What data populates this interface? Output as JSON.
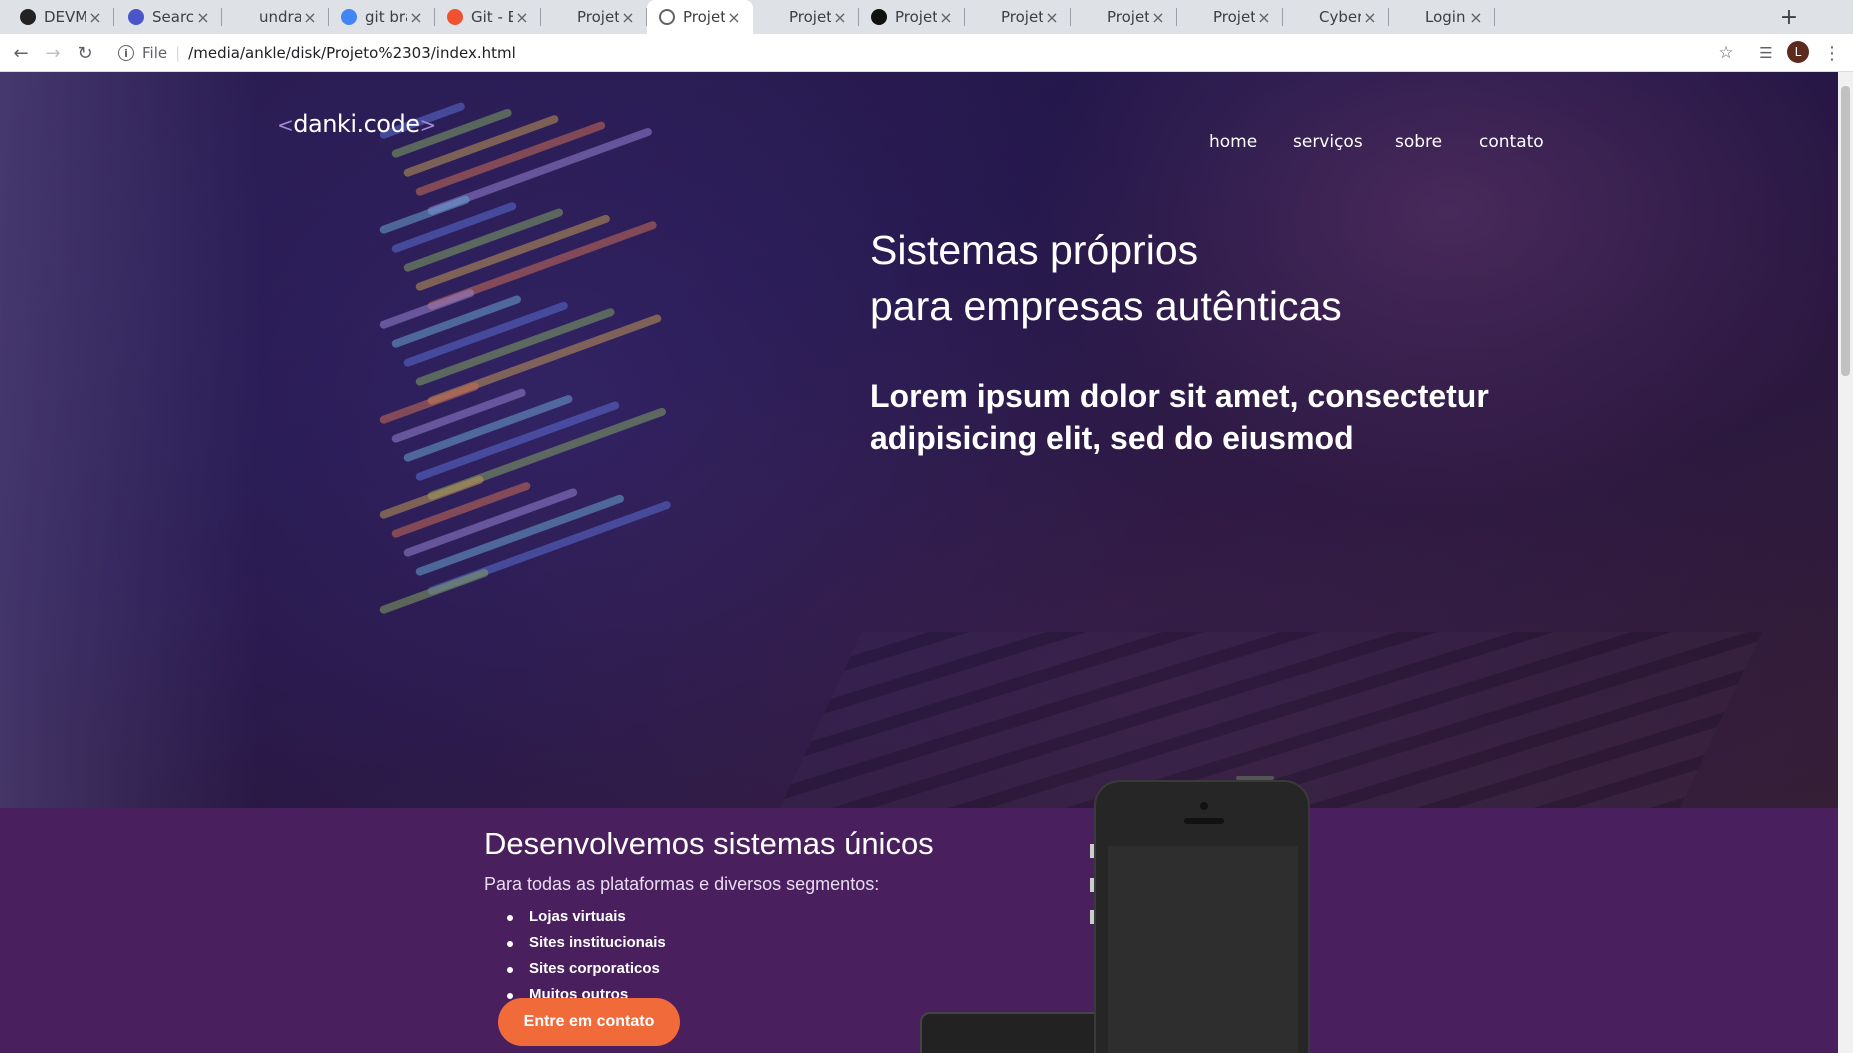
{
  "browser": {
    "tabs": [
      {
        "title": "DEVMO",
        "favicon": "devmo-icon",
        "active": false
      },
      {
        "title": "Search |",
        "favicon": "search-icon",
        "active": false
      },
      {
        "title": "undraw_",
        "favicon": "blank-icon",
        "active": false
      },
      {
        "title": "git branc",
        "favicon": "google-icon",
        "active": false
      },
      {
        "title": "Git - Basi",
        "favicon": "git-icon",
        "active": false
      },
      {
        "title": "Projeto C",
        "favicon": "blank-icon",
        "active": false
      },
      {
        "title": "Projeto C",
        "favicon": "globe-icon",
        "active": true
      },
      {
        "title": "Projeto C",
        "favicon": "blank-icon",
        "active": false
      },
      {
        "title": "Projeto C",
        "favicon": "dash-icon",
        "active": false
      },
      {
        "title": "Projeto C",
        "favicon": "blank-icon",
        "active": false
      },
      {
        "title": "Projeto #",
        "favicon": "blank-icon",
        "active": false
      },
      {
        "title": "Projeto#",
        "favicon": "blank-icon",
        "active": false
      },
      {
        "title": "Cyberpu",
        "favicon": "blank-icon",
        "active": false
      },
      {
        "title": "Login Fa",
        "favicon": "blank-icon",
        "active": false
      }
    ],
    "new_tab_label": "+",
    "close_glyph": "×",
    "address": {
      "scheme": "File",
      "url": "/media/ankle/disk/Projeto%2303/index.html"
    },
    "profile_initial": "L"
  },
  "page": {
    "logo": {
      "text": "danki.code",
      "left_bracket": "<",
      "right_bracket": ">"
    },
    "nav": [
      "home",
      "serviços",
      "sobre",
      "contato"
    ],
    "hero": {
      "title_line1": "Sistemas próprios",
      "title_line2": "para empresas autênticas",
      "subtitle": "Lorem ipsum dolor sit amet, consectetur adipisicing elit, sed do eiusmod"
    },
    "section2": {
      "title": "Desenvolvemos sistemas únicos",
      "subtitle": "Para todas as plataformas e diversos segmentos:",
      "items": [
        "Lojas virtuais",
        "Sites institucionais",
        "Sites corporaticos",
        "Muitos outros"
      ],
      "cta_label": "Entre em contato"
    }
  },
  "colors": {
    "section_purple": "#4a1f5e",
    "cta_orange": "#f06a3a",
    "hero_dark": "#22184a"
  }
}
